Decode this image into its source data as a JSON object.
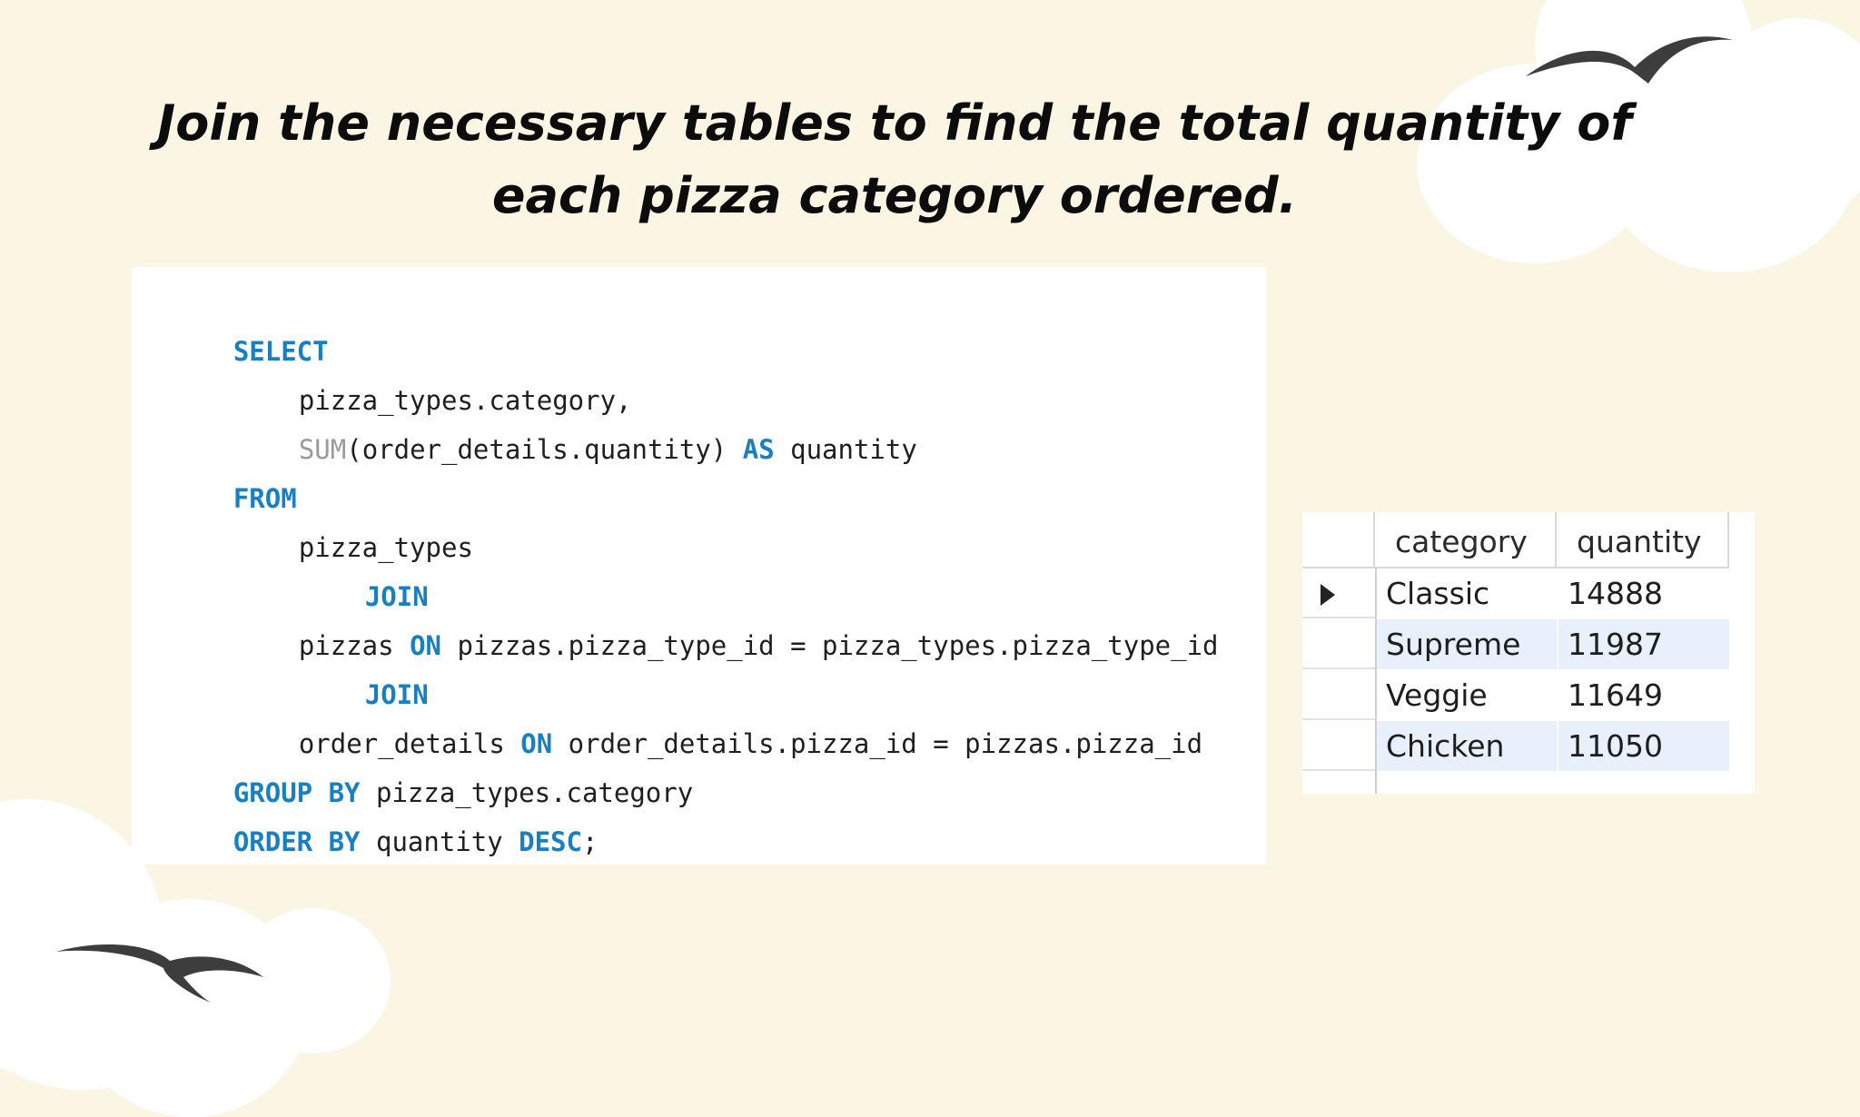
{
  "title": "Join the necessary tables to find the total quantity of each pizza category ordered.",
  "code": {
    "l1_kw": "SELECT",
    "l2_text": "pizza_types.category,",
    "l3_fn": "SUM",
    "l3_text": "(order_details.quantity) ",
    "l3_kw": "AS",
    "l3_tail": " quantity",
    "l4_kw": "FROM",
    "l5_text": "pizza_types",
    "l6_kw": "JOIN",
    "l7_a": "pizzas ",
    "l7_kw": "ON",
    "l7_b": " pizzas.pizza_type_id = pizza_types.pizza_type_id",
    "l8_kw": "JOIN",
    "l9_a": "order_details ",
    "l9_kw": "ON",
    "l9_b": " order_details.pizza_id = pizzas.pizza_id",
    "l10_kw": "GROUP BY",
    "l10_text": " pizza_types.category",
    "l11_kw1": "ORDER BY",
    "l11_text": " quantity ",
    "l11_kw2": "DESC",
    "l11_end": ";"
  },
  "result": {
    "columns": [
      "category",
      "quantity"
    ],
    "rows": [
      {
        "category": "Classic",
        "quantity": "14888"
      },
      {
        "category": "Supreme",
        "quantity": "11987"
      },
      {
        "category": "Veggie",
        "quantity": "11649"
      },
      {
        "category": "Chicken",
        "quantity": "11050"
      }
    ],
    "current_row_icon": "row-pointer-icon"
  },
  "decor": {
    "bird_icon": "bird-icon",
    "cloud_icon": "cloud-shape",
    "background": "#fbf6e4",
    "keyword_color": "#1a7fc1"
  }
}
